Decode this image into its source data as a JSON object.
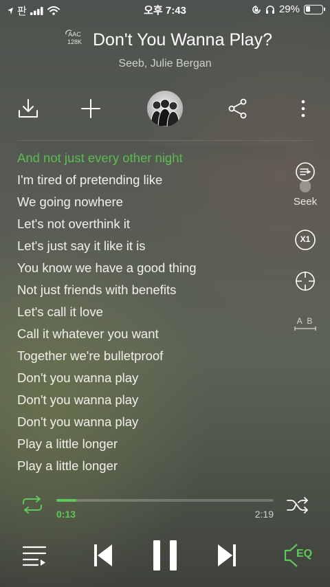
{
  "status_bar": {
    "carrier": "판",
    "time": "오후 7:43",
    "battery_percent": "29%",
    "battery_level": 0.29,
    "icons": [
      "location-arrow-icon",
      "signal-icon",
      "wifi-icon",
      "orientation-lock-icon",
      "headphones-icon",
      "battery-icon"
    ]
  },
  "track": {
    "codec_line1": "AAC",
    "codec_line2": "128K",
    "title": "Don't You Wanna Play?",
    "artist": "Seeb, Julie Bergan"
  },
  "actions": {
    "icons": [
      "download-icon",
      "add-icon",
      "album-art",
      "share-icon",
      "more-icon"
    ]
  },
  "lyrics": [
    "And not just every other night",
    "I'm tired of pretending like",
    "We going nowhere",
    "Let's not overthink it",
    "Let's just say it like it is",
    "You know we have a good thing",
    "Not just friends with benefits",
    "Let's call it love",
    "Call it whatever you want",
    "Together we're bulletproof",
    "Don't you wanna play",
    "Don't you wanna play",
    "Don't you wanna play",
    "Play a little longer",
    "Play a little longer"
  ],
  "active_lyric_index": 0,
  "side_controls": {
    "seek_label": "Seek",
    "speed_label": "X1",
    "ab_label": "A B",
    "icons": [
      "seek-toggle-icon",
      "speed-icon",
      "crosshair-icon",
      "ab-repeat-icon"
    ]
  },
  "playback": {
    "elapsed": "0:13",
    "duration": "2:19",
    "progress_fraction": 0.093,
    "accent_color": "#5ec956"
  },
  "bottom_controls": {
    "eq_label": "EQ",
    "icons": [
      "repeat-icon",
      "shuffle-icon",
      "playlist-icon",
      "previous-icon",
      "pause-icon",
      "next-icon",
      "eq-icon"
    ]
  }
}
